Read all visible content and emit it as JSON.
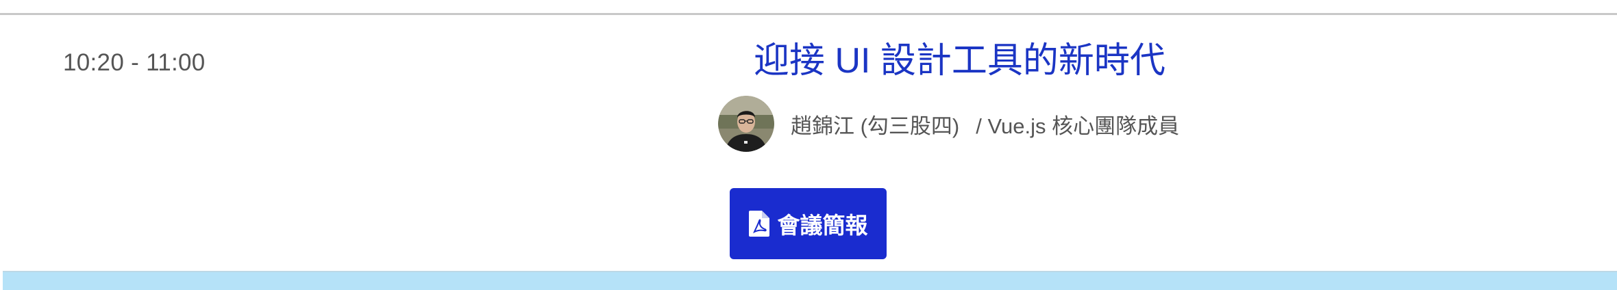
{
  "session": {
    "time": "10:20 - 11:00",
    "title": "迎接 UI 設計工具的新時代",
    "speaker": {
      "name": "趙錦江 (勾三股四)",
      "role": "/ Vue.js 核心團隊成員"
    },
    "slides_button": {
      "icon": "pdf-file-icon",
      "label": "會議簡報"
    }
  },
  "colors": {
    "title": "#1b35c4",
    "button_bg": "#1a2ccf",
    "band": "#b5e2f8",
    "muted_text": "#555555"
  }
}
